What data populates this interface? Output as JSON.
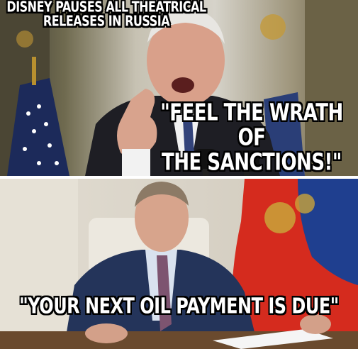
{
  "meme": {
    "headline": "DISNEY PAUSES ALL THEATRICAL\nRELEASES IN RUSSIA",
    "top_quote": "\"FEEL THE WRATH OF\nTHE SANCTIONS!\"",
    "bottom_quote": "\"YOUR NEXT OIL PAYMENT IS DUE\""
  },
  "colors": {
    "caption_fill": "#ffffff",
    "caption_outline": "#000000",
    "flag_red": "#d52b1e",
    "flag_blue": "#1f3f8f",
    "suit_dark": "#1e1e24",
    "suit_navy": "#24345a",
    "tie_purple": "#7d5470"
  }
}
